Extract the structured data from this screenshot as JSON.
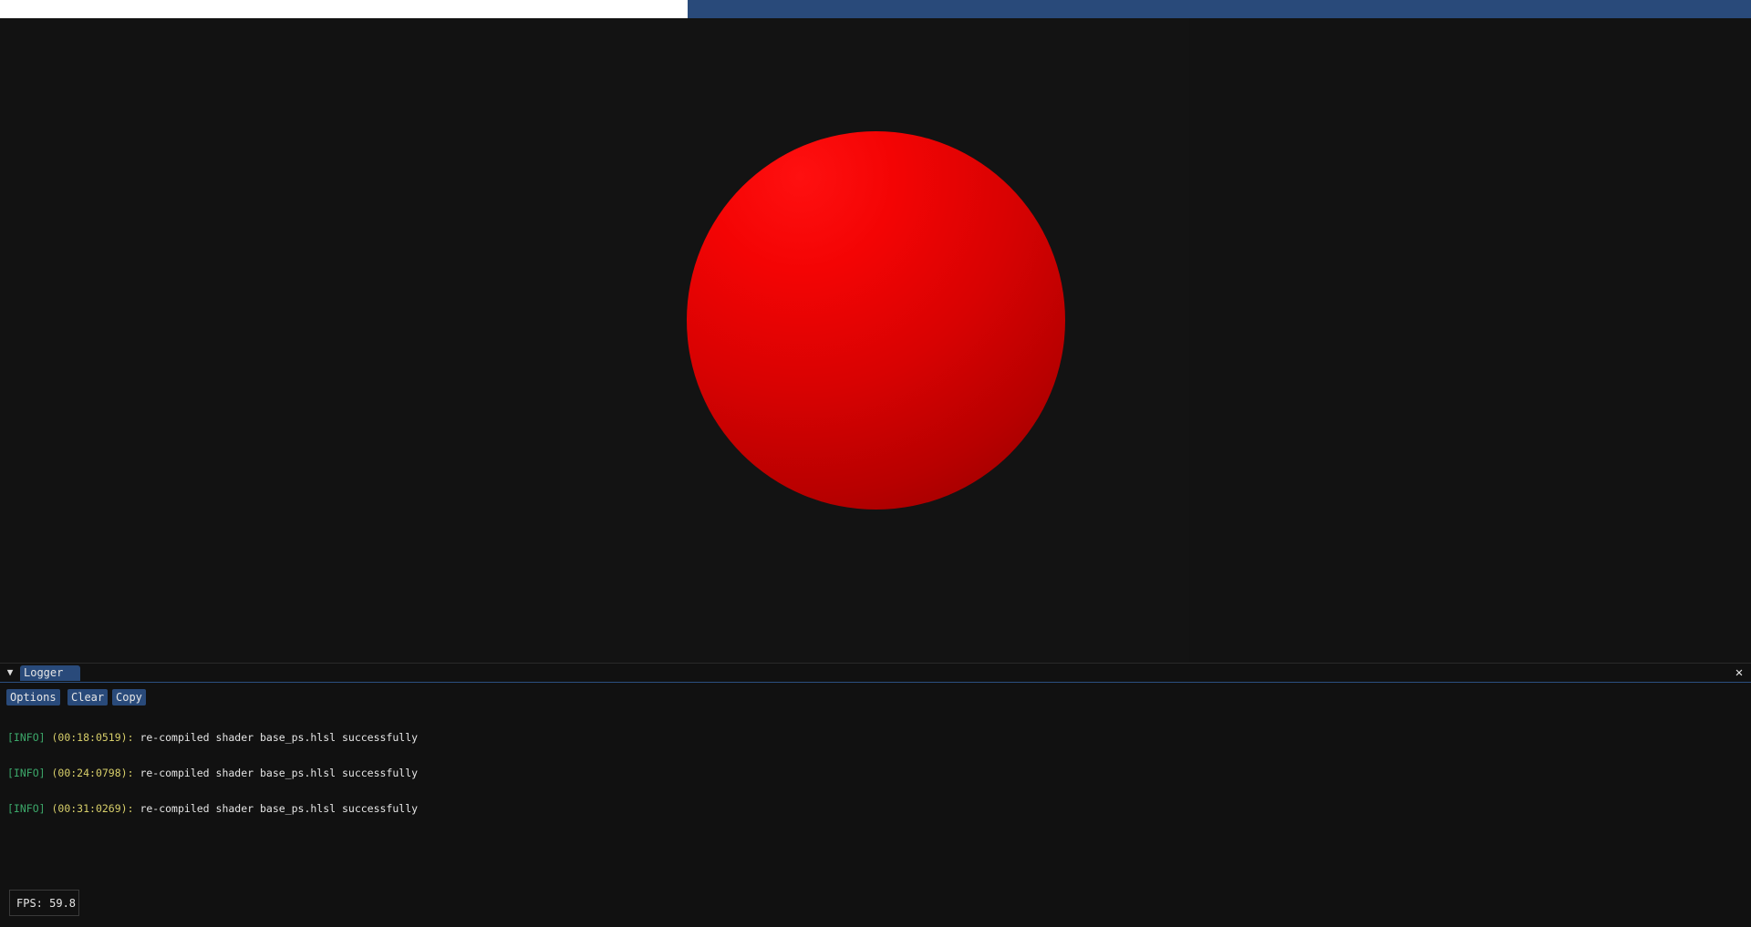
{
  "logger": {
    "tab_label": "Logger",
    "buttons": {
      "options": "Options",
      "clear": "Clear",
      "copy": "Copy"
    },
    "entries": [
      {
        "level": "[INFO]",
        "time": "(00:18:0519):",
        "message": "re-compiled shader base_ps.hlsl successfully"
      },
      {
        "level": "[INFO]",
        "time": "(00:24:0798):",
        "message": "re-compiled shader base_ps.hlsl successfully"
      },
      {
        "level": "[INFO]",
        "time": "(00:31:0269):",
        "message": "re-compiled shader base_ps.hlsl successfully"
      }
    ]
  },
  "fps": {
    "label": "FPS: 59.8"
  },
  "icons": {
    "collapse": "collapse-triangle-icon",
    "close": "close-icon"
  },
  "colors": {
    "accent": "#294a7a",
    "background": "#111111",
    "sphere": "#e00000",
    "log_level": "#3ca86a",
    "log_time": "#d8cf6a"
  }
}
